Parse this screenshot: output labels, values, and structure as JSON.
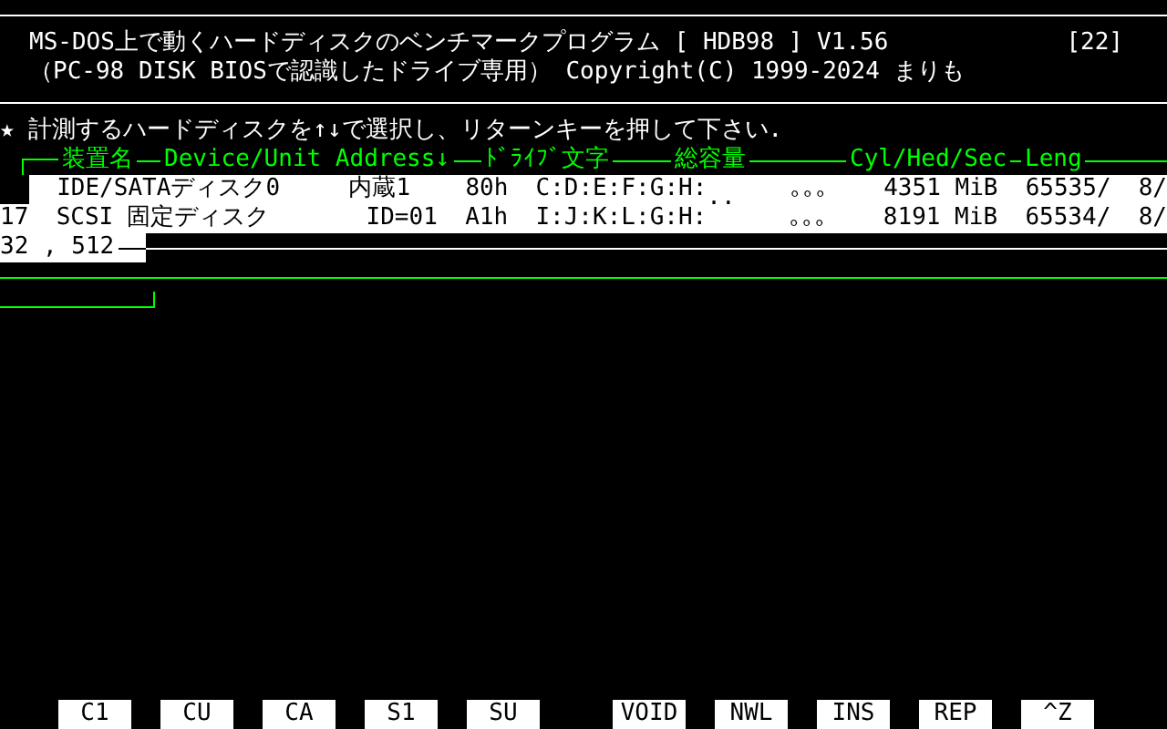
{
  "banner": {
    "title": "MS-DOS上で動くハードディスクのベンチマークプログラム [ HDB98 ] V1.56",
    "counter": "[22]",
    "subtitle": "（PC-98 DISK BIOSで認識したドライブ専用） Copyright(C) 1999-2024 まりも"
  },
  "prompt": "★ 計測するハードディスクを↑↓で選択し、リターンキーを押して下さい.",
  "columns": [
    "装置名",
    "Device/Unit Address↓",
    "ﾄﾞﾗｲﾌﾞ文字",
    "総容量",
    "Cyl/Hed/Sec",
    "Leng"
  ],
  "drives": [
    {
      "cells": [
        "IDE/SATAディスク0",
        "内蔵1",
        "80h",
        "C:D:E:F:G:H:",
        "..",
        "｡｡｡",
        "4351 MiB",
        "65535/",
        "8/"
      ]
    },
    {
      "cells": [
        "17",
        "SCSI",
        "固定ディスク",
        "ID=01",
        "A1h",
        "I:J:K:L:G:H:",
        "｡｡｡",
        "8191 MiB",
        "65534/",
        "8/"
      ]
    },
    {
      "cells": [
        "32 , 512"
      ]
    }
  ],
  "function_keys": [
    [
      "C1",
      "CU",
      "CA",
      "S1",
      "SU"
    ],
    [
      "VOID",
      "NWL",
      "INS",
      "REP",
      "^Z"
    ]
  ]
}
